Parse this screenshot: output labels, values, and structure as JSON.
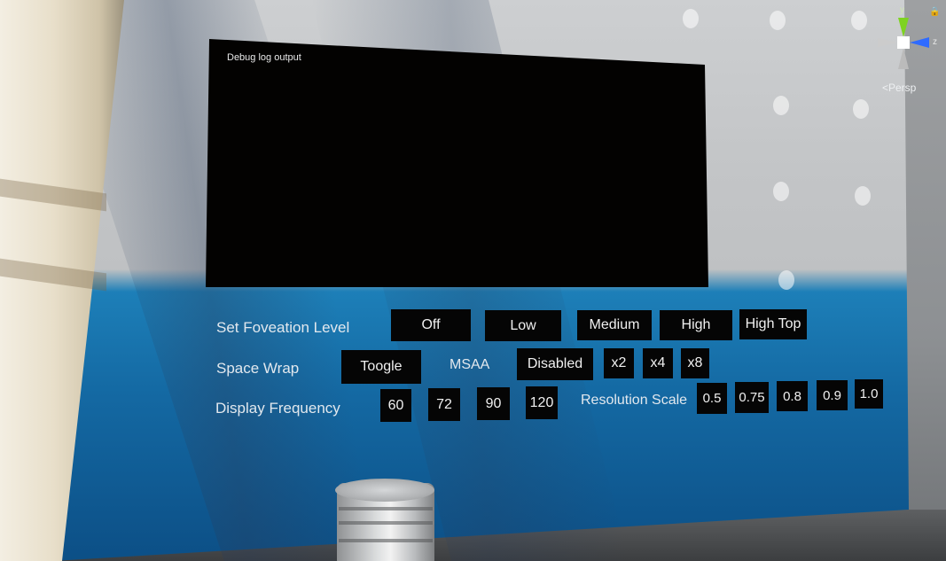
{
  "debug": {
    "title": "Debug log output"
  },
  "rows": {
    "foveation": {
      "label": "Set Foveation Level",
      "options": [
        "Off",
        "Low",
        "Medium",
        "High",
        "High Top"
      ]
    },
    "spacewrap": {
      "label": "Space Wrap",
      "toggle": "Toogle"
    },
    "msaa": {
      "label": "MSAA",
      "options": [
        "Disabled",
        "x2",
        "x4",
        "x8"
      ]
    },
    "frequency": {
      "label": "Display Frequency",
      "options": [
        "60",
        "72",
        "90",
        "120"
      ]
    },
    "resolution": {
      "label": "Resolution Scale",
      "options": [
        "0.5",
        "0.75",
        "0.8",
        "0.9",
        "1.0"
      ]
    }
  },
  "gizmo": {
    "y": "y",
    "z": "z",
    "projection": "<Persp",
    "colors": {
      "y": "#7ed321",
      "z": "#2f6bff",
      "x": "#cccccc"
    }
  }
}
